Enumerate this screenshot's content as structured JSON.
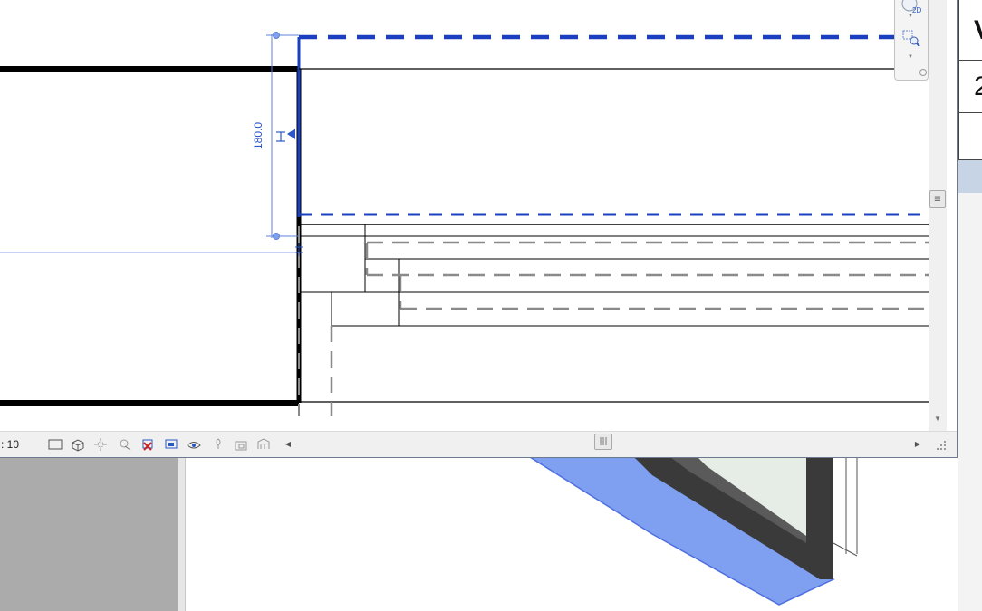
{
  "view": {
    "scale_label": ": 10",
    "dimension_value": "180.0"
  },
  "schedule": {
    "cells": [
      "V",
      "2"
    ]
  },
  "status_bar": {
    "icons": [
      "detail-level-icon",
      "visual-style-icon",
      "sun-path-icon",
      "shadows-icon",
      "crop-view-icon",
      "show-crop-region-icon",
      "temporary-hide-isolate-icon",
      "reveal-hidden-icon",
      "lock-3d-view-icon",
      "analytical-model-icon",
      "highlight-displacement-icon"
    ]
  },
  "navigation_bar": {
    "items": [
      "2d-wheel-icon",
      "zoom-region-icon"
    ]
  },
  "colors": {
    "selection_blue": "#1a3fbf",
    "dimension_blue": "#2a56c6",
    "model_line": "#000000",
    "hidden_line_gray": "#8a8a8a",
    "glass_blue": "#7f9ff0"
  }
}
